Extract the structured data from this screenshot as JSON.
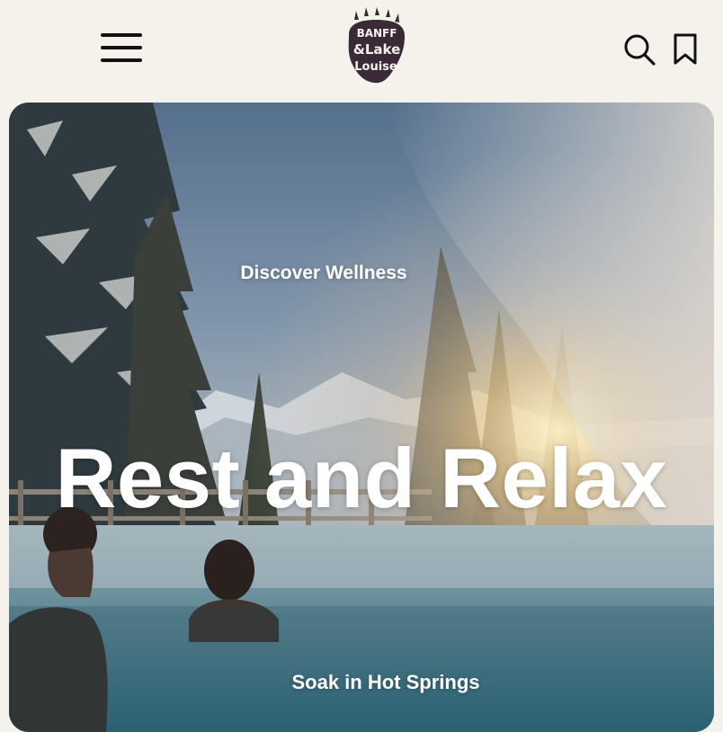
{
  "header": {
    "menu_icon": "hamburger-menu-icon",
    "logo": {
      "text_line1": "BANFF",
      "text_line2": "&Lake",
      "text_line3": "Louise",
      "icon": "bear-paw-logo",
      "color": "#3a2a35"
    },
    "search_icon": "search-icon",
    "bookmark_icon": "bookmark-icon"
  },
  "hero": {
    "eyebrow": "Discover Wellness",
    "headline": "Rest and Relax",
    "subheading": "Soak in Hot Springs"
  },
  "colors": {
    "background": "#f5f2ec",
    "icon": "#111111",
    "hero_text": "#ffffff"
  }
}
